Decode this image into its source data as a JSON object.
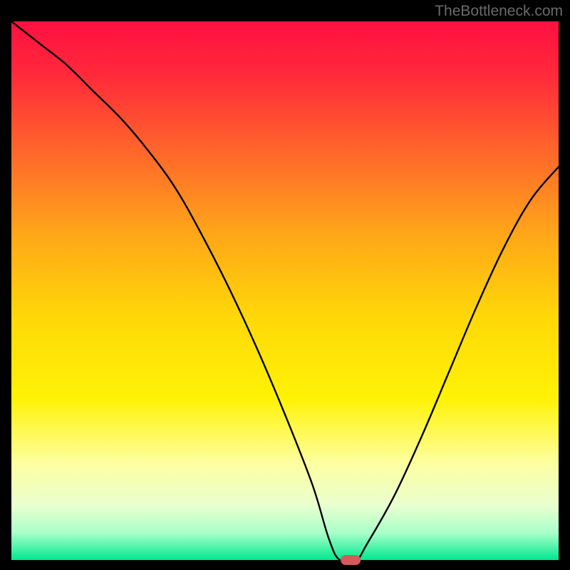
{
  "attribution": "TheBottleneck.com",
  "chart_data": {
    "type": "line",
    "title": "",
    "xlabel": "",
    "ylabel": "",
    "xlim": [
      0,
      100
    ],
    "ylim": [
      0,
      100
    ],
    "x": [
      0,
      5,
      10,
      15,
      20,
      25,
      30,
      35,
      40,
      45,
      50,
      55,
      58,
      60,
      63,
      65,
      70,
      75,
      80,
      85,
      90,
      95,
      100
    ],
    "values": [
      100,
      96,
      92,
      87,
      82,
      76,
      69,
      60,
      50,
      39,
      27,
      14,
      4,
      0,
      0,
      3,
      12,
      23,
      35,
      47,
      58,
      67,
      73
    ],
    "marker": {
      "x": 62,
      "y": 0,
      "color": "#d65a5a"
    },
    "gradient_stops": [
      {
        "offset": 0.0,
        "color": "#ff1040"
      },
      {
        "offset": 0.1,
        "color": "#ff2a3a"
      },
      {
        "offset": 0.25,
        "color": "#ff6a2a"
      },
      {
        "offset": 0.4,
        "color": "#ffa818"
      },
      {
        "offset": 0.55,
        "color": "#ffd808"
      },
      {
        "offset": 0.7,
        "color": "#fff205"
      },
      {
        "offset": 0.82,
        "color": "#fdffa0"
      },
      {
        "offset": 0.9,
        "color": "#e8ffd0"
      },
      {
        "offset": 0.95,
        "color": "#a8ffc8"
      },
      {
        "offset": 1.0,
        "color": "#00e890"
      }
    ]
  }
}
